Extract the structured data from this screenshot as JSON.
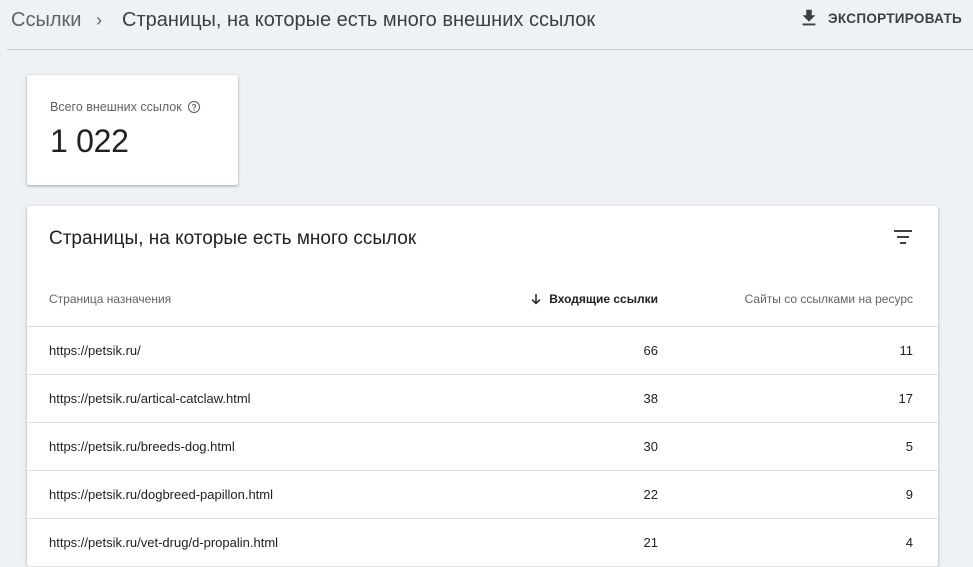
{
  "header": {
    "breadcrumb_root": "Ссылки",
    "breadcrumb_separator": "›",
    "page_title": "Страницы, на которые есть много внешних ссылок",
    "export_label": "ЭКСПОРТИРОВАТЬ"
  },
  "summary": {
    "label": "Всего внешних ссылок",
    "value": "1 022"
  },
  "table": {
    "title": "Страницы, на которые есть много ссылок",
    "columns": {
      "page": "Страница назначения",
      "incoming": "Входящие ссылки",
      "sites": "Сайты со ссылками на ресурс"
    },
    "rows": [
      {
        "url": "https://petsik.ru/",
        "incoming": "66",
        "sites": "11"
      },
      {
        "url": "https://petsik.ru/artical-catclaw.html",
        "incoming": "38",
        "sites": "17"
      },
      {
        "url": "https://petsik.ru/breeds-dog.html",
        "incoming": "30",
        "sites": "5"
      },
      {
        "url": "https://petsik.ru/dogbreed-papillon.html",
        "incoming": "22",
        "sites": "9"
      },
      {
        "url": "https://petsik.ru/vet-drug/d-propalin.html",
        "incoming": "21",
        "sites": "4"
      }
    ]
  },
  "icons": {
    "export": "download-icon",
    "help": "help-circle-icon",
    "filter": "filter-icon",
    "sort": "arrow-down-icon"
  }
}
